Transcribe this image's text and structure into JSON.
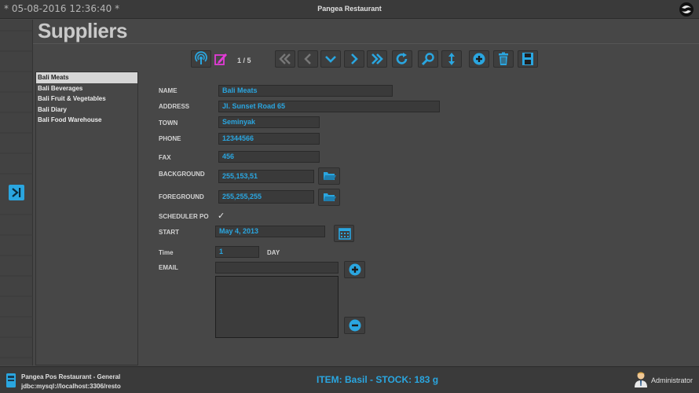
{
  "window": {
    "datetime": "* 05-08-2016 12:36:40 *",
    "title": "Pangea Restaurant"
  },
  "header": {
    "title": "Suppliers"
  },
  "toolbar": {
    "pager": "1 / 5"
  },
  "list": {
    "items": [
      "Bali Meats",
      "Bali Beverages",
      "Bali Fruit & Vegetables",
      "Bali Diary",
      "Bali Food Warehouse"
    ],
    "selected_index": 0
  },
  "form": {
    "name": {
      "label": "NAME",
      "value": "Bali Meats"
    },
    "address": {
      "label": "ADDRESS",
      "value": "Jl. Sunset Road 65"
    },
    "town": {
      "label": "TOWN",
      "value": "Seminyak"
    },
    "phone": {
      "label": "PHONE",
      "value": "12344566"
    },
    "fax": {
      "label": "FAX",
      "value": "456"
    },
    "background": {
      "label": "BACKGROUND",
      "value": "255,153,51"
    },
    "foreground": {
      "label": "FOREGROUND",
      "value": "255,255,255"
    },
    "scheduler": {
      "label": "SCHEDULER PO",
      "check": "✓"
    },
    "start": {
      "label": "START",
      "value": "May 4, 2013"
    },
    "time": {
      "label": "Time",
      "value": "1",
      "unit": "DAY"
    },
    "email": {
      "label": "EMAIL",
      "value": ""
    }
  },
  "status": {
    "line1": "Pangea Pos Restaurant - General",
    "line2": "jdbc:mysql://localhost:3306/resto",
    "item_stock": "ITEM: Basil  - STOCK: 183 g",
    "user": "Administrator"
  },
  "colors": {
    "accent": "#2aa6e0",
    "magenta": "#e23bd6",
    "background": "#474747"
  }
}
